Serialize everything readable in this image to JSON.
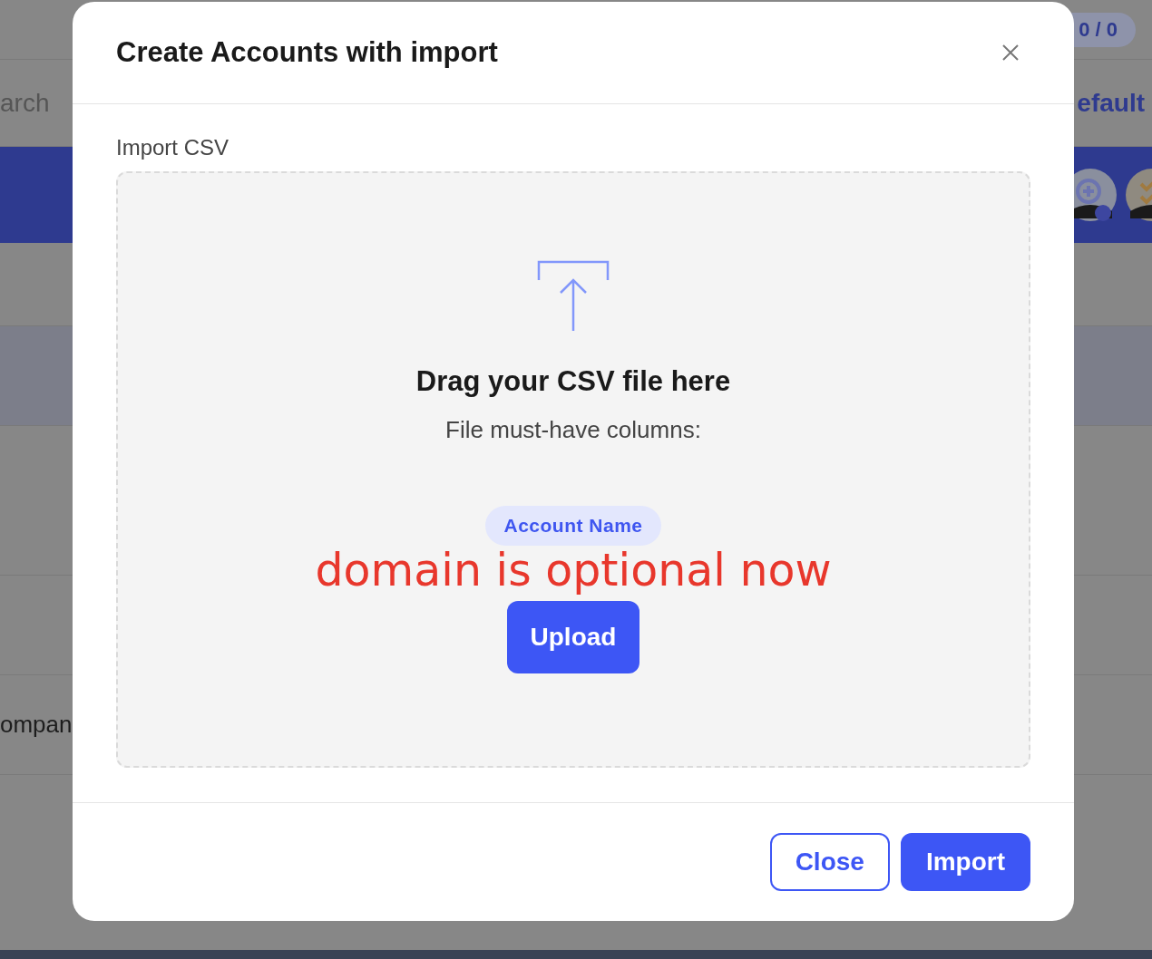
{
  "background": {
    "counter": "0 / 0",
    "search_text": "arch",
    "view_text": "efault",
    "row_text": "ompan"
  },
  "dialog": {
    "title": "Create Accounts with import",
    "field_label": "Import CSV",
    "dropzone": {
      "heading": "Drag your CSV file here",
      "subheading": "File must-have columns:",
      "columns": [
        "Account Name"
      ],
      "note": "domain is optional now",
      "upload_button": "Upload"
    },
    "buttons": [
      {
        "label": "Close",
        "kind": "secondary"
      },
      {
        "label": "Import",
        "kind": "primary"
      }
    ]
  }
}
